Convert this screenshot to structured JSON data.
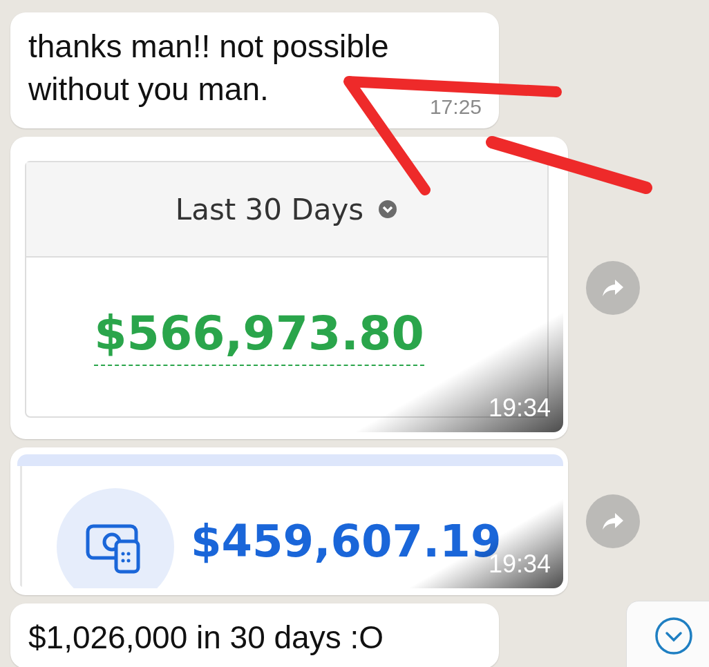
{
  "messages": [
    {
      "kind": "text",
      "text": "thanks man!! not possible without you man.",
      "time": "17:25"
    },
    {
      "kind": "stats_image",
      "header": "Last 30 Days",
      "amount": "$566,973.80",
      "time": "19:34",
      "forward": true
    },
    {
      "kind": "balance_image",
      "amount": "$459,607.19",
      "time": "19:34",
      "forward": true
    },
    {
      "kind": "text",
      "text": "$1,026,000 in 30 days :O"
    }
  ]
}
